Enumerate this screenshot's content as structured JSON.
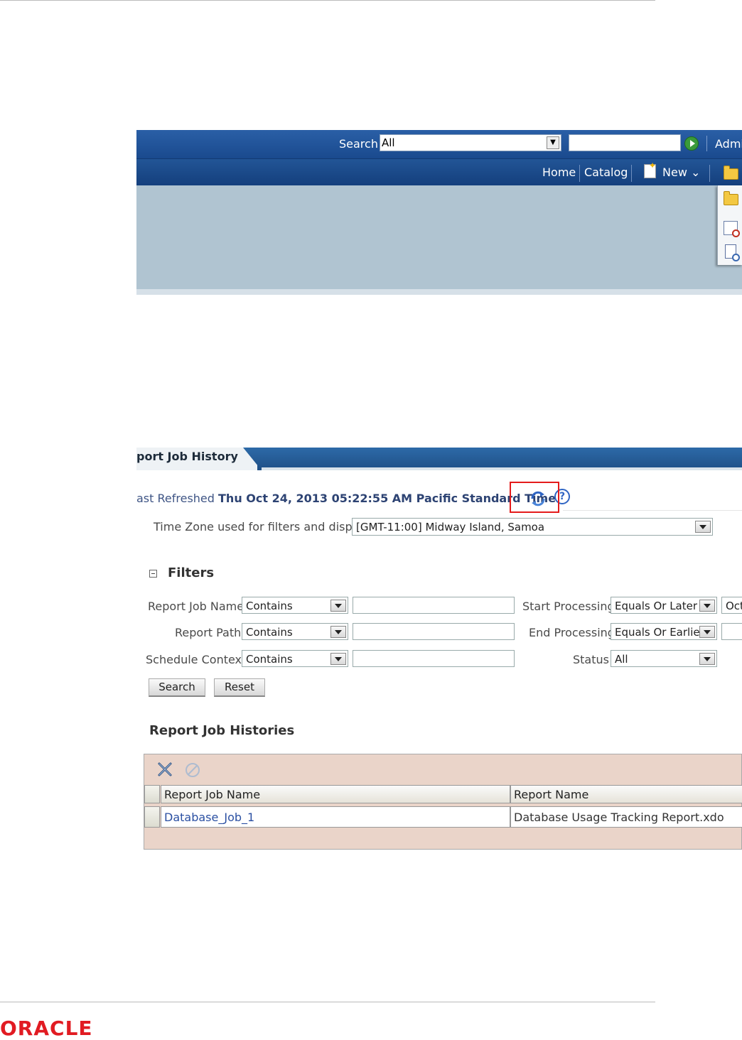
{
  "top_bar": {
    "search_label": "Search",
    "search_scope": "All",
    "search_text": "",
    "admin_label": "Admi"
  },
  "nav_bar": {
    "home": "Home",
    "catalog": "Catalog",
    "new": "New ⌄"
  },
  "job_history": {
    "title": "port Job History",
    "last_refreshed_label": "ast Refreshed",
    "last_refreshed_value": "Thu Oct 24, 2013 05:22:55 AM Pacific Standard Time",
    "timezone_label": "Time Zone used for filters and display",
    "timezone_value": "[GMT-11:00] Midway Island, Samoa",
    "filters_title": "Filters",
    "filters": {
      "report_job_name_label": "Report Job Name",
      "report_job_name_op": "Contains",
      "report_path_label": "Report Path",
      "report_path_op": "Contains",
      "schedule_context_label": "Schedule Context",
      "schedule_context_op": "Contains",
      "start_processing_label": "Start Processing",
      "start_processing_op": "Equals Or Later",
      "start_processing_value": "Oct",
      "end_processing_label": "End Processing",
      "end_processing_op": "Equals Or Earlie",
      "status_label": "Status",
      "status_value": "All"
    },
    "search_button": "Search",
    "reset_button": "Reset",
    "histories_title": "Report Job Histories",
    "table": {
      "columns": [
        "Report Job Name",
        "Report Name"
      ],
      "rows": [
        {
          "job_name": "Database_Job_1",
          "report_name": "Database Usage Tracking Report.xdo"
        }
      ]
    }
  },
  "footer": {
    "logo_text": "ORACLE"
  },
  "colors": {
    "brand_red": "#e11b22",
    "header_blue": "#1f4f86",
    "highlight": "#e41b1b",
    "table_bg": "#ead4c9"
  }
}
